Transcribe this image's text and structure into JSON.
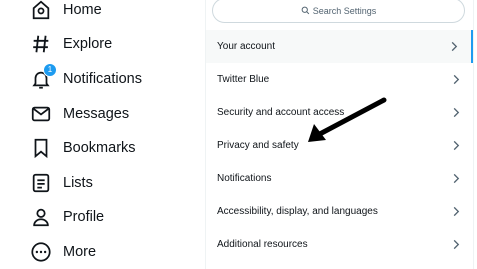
{
  "nav": {
    "items": [
      {
        "label": "Home",
        "icon": "home-icon"
      },
      {
        "label": "Explore",
        "icon": "hashtag-icon"
      },
      {
        "label": "Notifications",
        "icon": "bell-icon",
        "badge": "1"
      },
      {
        "label": "Messages",
        "icon": "envelope-icon"
      },
      {
        "label": "Bookmarks",
        "icon": "bookmark-icon"
      },
      {
        "label": "Lists",
        "icon": "list-icon"
      },
      {
        "label": "Profile",
        "icon": "person-icon"
      },
      {
        "label": "More",
        "icon": "more-circle-icon"
      }
    ]
  },
  "settings": {
    "search_placeholder": "Search Settings",
    "rows": [
      {
        "label": "Your account",
        "active": true
      },
      {
        "label": "Twitter Blue"
      },
      {
        "label": "Security and account access"
      },
      {
        "label": "Privacy and safety"
      },
      {
        "label": "Notifications"
      },
      {
        "label": "Accessibility, display, and languages"
      },
      {
        "label": "Additional resources"
      }
    ]
  },
  "colors": {
    "accent": "#1d9bf0",
    "text": "#0f1419",
    "muted": "#536471",
    "annotation": "#000000"
  }
}
